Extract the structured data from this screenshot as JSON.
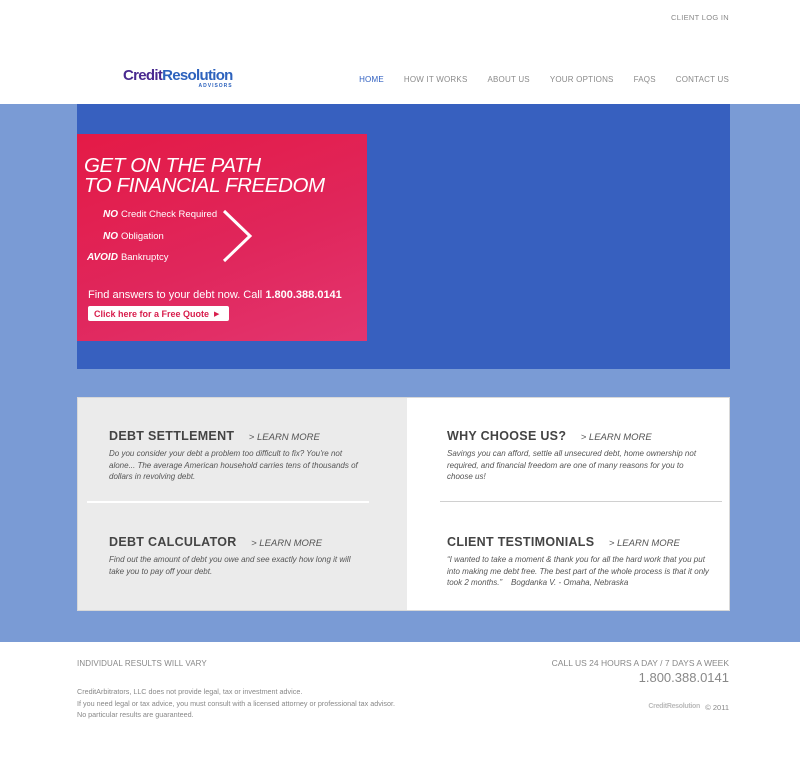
{
  "header": {
    "client_login": "CLIENT LOG IN",
    "logo": {
      "part1": "Credit",
      "part2": "Resolution",
      "sub": "ADVISORS"
    },
    "nav": [
      "HOME",
      "HOW IT WORKS",
      "ABOUT US",
      "YOUR OPTIONS",
      "FAQS",
      "CONTACT US"
    ],
    "active_nav": "HOME"
  },
  "promo": {
    "title_line1": "GET ON THE PATH",
    "title_line2": "TO FINANCIAL FREEDOM",
    "bullets": [
      {
        "em": "NO",
        "text": "Credit Check Required"
      },
      {
        "em": "NO",
        "text": "Obligation"
      },
      {
        "em": "AVOID",
        "text": "Bankruptcy"
      }
    ],
    "call_text": "Find answers to your debt now. Call",
    "phone": "1.800.388.0141",
    "button_label": "Click here for a Free Quote",
    "button_arrow": "▶"
  },
  "cards": [
    {
      "title": "DEBT SETTLEMENT",
      "link": "> LEARN MORE",
      "text": "Do you consider your debt a problem too difficult to fix? You're not alone... The average American household carries tens of thousands of dollars in revolving debt."
    },
    {
      "title": "DEBT CALCULATOR",
      "link": "> LEARN MORE",
      "text": "Find out the amount of debt you owe and see exactly how long it will take you to pay off your debt."
    },
    {
      "title": "WHY CHOOSE US?",
      "link": "> LEARN MORE",
      "text": "Savings you can afford, settle all unsecured debt, home ownership not required, and financial freedom are one of many reasons for you to choose us!"
    },
    {
      "title": "CLIENT TESTIMONIALS",
      "link": "> LEARN MORE",
      "text": "“I wanted to take a moment & thank you for all the hard work that you put into making me debt free. The best part of the whole process is that it only took 2 months.”",
      "author": "Bogdanka V. - Omaha, Nebraska"
    }
  ],
  "footer": {
    "results": "INDIVIDUAL RESULTS WILL VARY",
    "disclaimer": [
      "CreditArbitrators, LLC does not provide legal, tax or investment advice.",
      "If you need legal or tax advice, you must consult with a licensed attorney or professional tax advisor.",
      "No particular results are guaranteed."
    ],
    "call_label": "CALL US 24 HOURS A DAY / 7 DAYS A WEEK",
    "phone": "1.800.388.0141",
    "logo": "CreditResolution",
    "copyright": "© 2011"
  },
  "colors": {
    "brand_purple": "#4a2a90",
    "brand_blue": "#2d62bd",
    "hero_blue": "#3760bf",
    "band_blue": "#7a9bd5",
    "promo_red": "#e41a46",
    "promo_pink": "#e3356f"
  }
}
